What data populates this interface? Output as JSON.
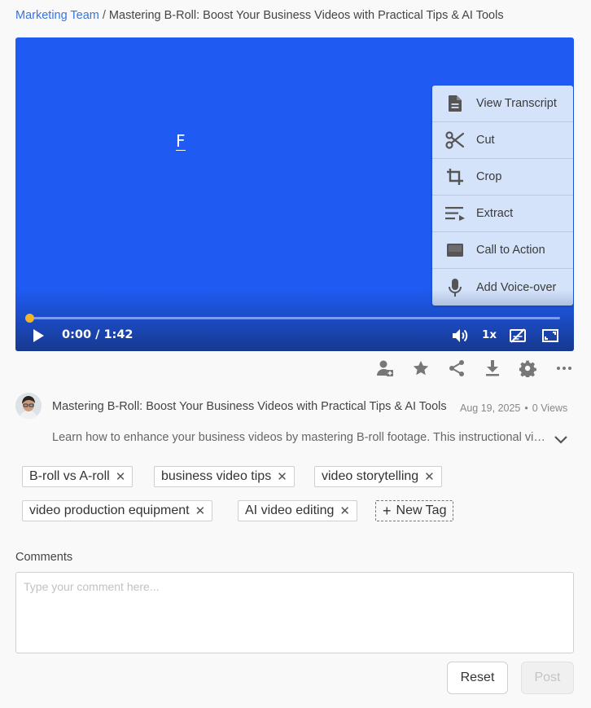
{
  "breadcrumb": {
    "parent": "Marketing Team",
    "separator": "/",
    "current": "Mastering B-Roll: Boost Your Business Videos with Practical Tips & AI Tools"
  },
  "player": {
    "frame_text": "F",
    "current_time": "0:00",
    "duration": "1:42",
    "time_display": "0:00 / 1:42",
    "speed": "1x",
    "progress": 0,
    "icons": [
      "play-icon",
      "volume-icon",
      "captions-off-icon",
      "fullscreen-icon"
    ],
    "colors": {
      "background": "#1f5bf2",
      "progress": "#f5b326"
    }
  },
  "video_menu": {
    "items": [
      {
        "label": "View Transcript",
        "icon": "document-icon"
      },
      {
        "label": "Cut",
        "icon": "scissors-icon"
      },
      {
        "label": "Crop",
        "icon": "crop-icon"
      },
      {
        "label": "Extract",
        "icon": "extract-icon"
      },
      {
        "label": "Call to Action",
        "icon": "call-to-action-icon"
      },
      {
        "label": "Add Voice-over",
        "icon": "microphone-icon"
      }
    ]
  },
  "actions": {
    "icons": [
      "add-user-icon",
      "star-icon",
      "share-icon",
      "download-icon",
      "settings-icon",
      "more-icon"
    ]
  },
  "video": {
    "title": "Mastering B-Roll: Boost Your Business Videos with Practical Tips & AI Tools",
    "date": "Aug 19, 2025",
    "views": "0 Views",
    "description": "Learn how to enhance your business videos by mastering B-roll footage. This instructional video explains what B-roll is and how to use it effectively."
  },
  "tags": {
    "items": [
      "B-roll vs A-roll",
      "business video tips",
      "video storytelling",
      "video production equipment",
      "AI video editing"
    ],
    "new_label": "New Tag"
  },
  "comments": {
    "label": "Comments",
    "placeholder": "Type your comment here...",
    "value": "",
    "reset_label": "Reset",
    "post_label": "Post"
  }
}
